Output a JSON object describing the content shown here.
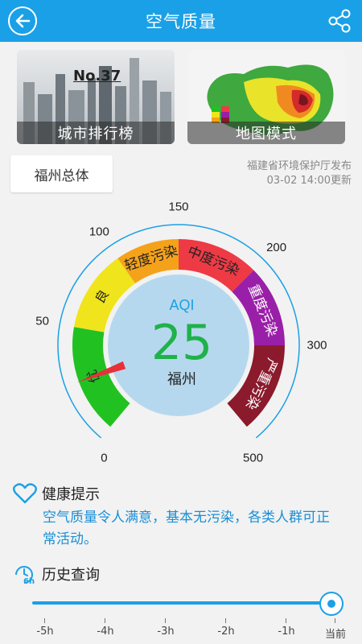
{
  "header": {
    "title": "空气质量"
  },
  "cards": {
    "ranking": {
      "caption": "城市排行榜",
      "rank": "No.37"
    },
    "map": {
      "caption": "地图模式"
    }
  },
  "location": {
    "city_area": "福州总体",
    "publisher": "福建省环境保护厅发布",
    "updated": "03-02 14:00更新"
  },
  "gauge": {
    "aqi_label": "AQI",
    "aqi_value": "25",
    "aqi_numeric": 25,
    "city": "福州",
    "scale_labels": [
      "0",
      "50",
      "100",
      "150",
      "200",
      "300",
      "500"
    ],
    "levels": [
      {
        "name": "优",
        "color": "#22c122"
      },
      {
        "name": "良",
        "color": "#f0e41c"
      },
      {
        "name": "轻度污染",
        "color": "#f5a21b"
      },
      {
        "name": "中度污染",
        "color": "#ee3a45"
      },
      {
        "name": "重度污染",
        "color": "#9a1fa8"
      },
      {
        "name": "严重污染",
        "color": "#8a1a2c"
      }
    ],
    "center_color": "#b6d8ee",
    "pointer_color": "#e8303a"
  },
  "health": {
    "title": "健康提示",
    "text": "空气质量令人满意，基本无污染，各类人群可正常活动。"
  },
  "history": {
    "title": "历史查询",
    "icon_badge": "6h",
    "ticks": [
      "-5h",
      "-4h",
      "-3h",
      "-2h",
      "-1h",
      "当前"
    ],
    "selected_index": 5
  },
  "colors": {
    "accent": "#1aa0e6",
    "health_text": "#1a8fd6"
  }
}
